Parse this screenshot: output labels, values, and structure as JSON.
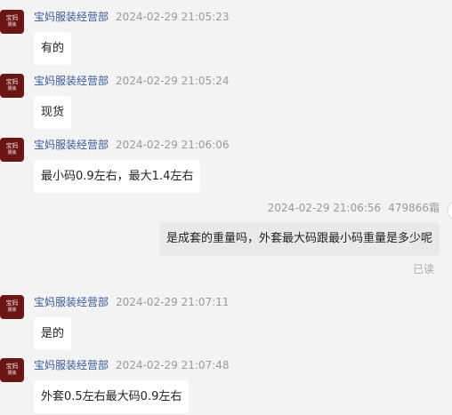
{
  "sender_name": "宝妈服装经营部",
  "avatar_text_line1": "宝妈",
  "avatar_text_line2": "服装",
  "messages": [
    {
      "time": "2024-02-29 21:05:23",
      "text": "有的"
    },
    {
      "time": "2024-02-29 21:05:24",
      "text": "现货"
    },
    {
      "time": "2024-02-29 21:06:06",
      "text": "最小码0.9左右，最大1.4左右"
    },
    {
      "time": "2024-02-29 21:07:11",
      "text": "是的"
    },
    {
      "time": "2024-02-29 21:07:48",
      "text": "外套0.5左右最大码0.9左右"
    }
  ],
  "own_message": {
    "time": "2024-02-29 21:06:56",
    "user": "479866霜",
    "text": "是成套的重量吗，外套最大码跟最小码重量是多少呢",
    "status": "已读"
  },
  "colors": {
    "background": "#f3f3f3",
    "sender_name": "#3a5a9a",
    "avatar_bg": "#6b1515",
    "incoming_bubble": "#ffffff",
    "outgoing_bubble": "#e9e9e9"
  }
}
